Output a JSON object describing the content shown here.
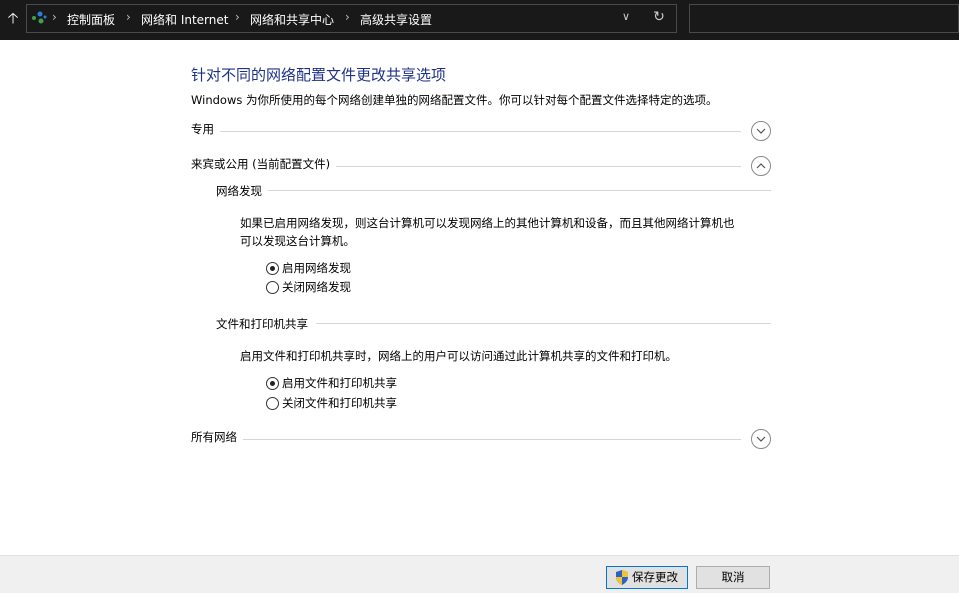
{
  "navigation": {
    "breadcrumbs": [
      "控制面板",
      "网络和 Internet",
      "网络和共享中心",
      "高级共享设置"
    ]
  },
  "content": {
    "title": "针对不同的网络配置文件更改共享选项",
    "description": "Windows 为你所使用的每个网络创建单独的网络配置文件。你可以针对每个配置文件选择特定的选项。",
    "sections": {
      "private": {
        "label": "专用",
        "expanded": false
      },
      "guest_public": {
        "label": "来宾或公用 (当前配置文件)",
        "expanded": true
      },
      "all_networks": {
        "label": "所有网络",
        "expanded": false
      }
    },
    "network_discovery": {
      "heading": "网络发现",
      "description_line1": "如果已启用网络发现，则这台计算机可以发现网络上的其他计算机和设备，而且其他网络计算机也",
      "description_line2": "可以发现这台计算机。",
      "options": [
        "启用网络发现",
        "关闭网络发现"
      ],
      "selected": "启用网络发现"
    },
    "file_printer_sharing": {
      "heading": "文件和打印机共享",
      "description": "启用文件和打印机共享时，网络上的用户可以访问通过此计算机共享的文件和打印机。",
      "options": [
        "启用文件和打印机共享",
        "关闭文件和打印机共享"
      ],
      "selected": "启用文件和打印机共享"
    }
  },
  "footer": {
    "save_label": "保存更改",
    "cancel_label": "取消"
  },
  "colors": {
    "title_blue": "#1e3287",
    "topbar_bg": "#191919",
    "footer_bg": "#f0f0f0"
  },
  "icons": [
    "up-arrow-icon",
    "network-icon",
    "chevron-right-icon",
    "chevron-down-icon",
    "refresh-icon",
    "chevron-up-icon",
    "uac-shield-icon"
  ]
}
